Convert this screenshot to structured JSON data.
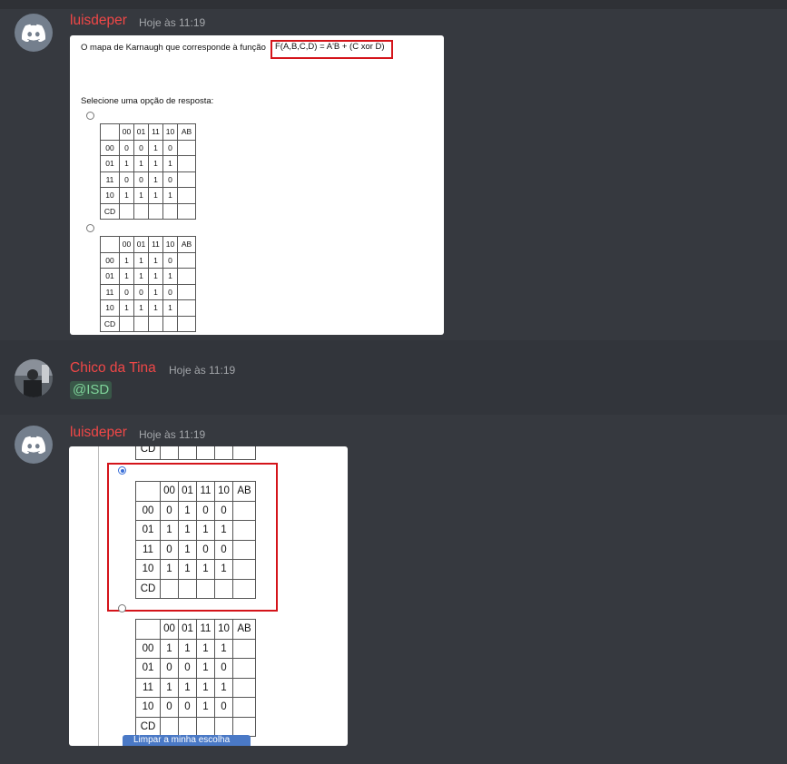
{
  "messages": [
    {
      "username": "luisdeper",
      "timestamp": "Hoje às 11:19"
    },
    {
      "username": "Chico da Tina",
      "timestamp": "Hoje às 11:19",
      "mention": "@ISD"
    },
    {
      "username": "luisdeper",
      "timestamp": "Hoje às 11:19"
    }
  ],
  "screenshot1": {
    "question": "O mapa de Karnaugh que corresponde  à função",
    "formula": "F(A,B,C,D) = A'B + (C xor D)",
    "select_text": "Selecione uma opção de resposta:",
    "header": [
      "",
      "00",
      "01",
      "11",
      "10",
      "AB"
    ],
    "tables": [
      [
        [
          "00",
          "0",
          "0",
          "1",
          "0",
          ""
        ],
        [
          "01",
          "1",
          "1",
          "1",
          "1",
          ""
        ],
        [
          "11",
          "0",
          "0",
          "1",
          "0",
          ""
        ],
        [
          "10",
          "1",
          "1",
          "1",
          "1",
          ""
        ],
        [
          "CD",
          "",
          "",
          "",
          "",
          ""
        ]
      ],
      [
        [
          "00",
          "1",
          "1",
          "1",
          "0",
          ""
        ],
        [
          "01",
          "1",
          "1",
          "1",
          "1",
          ""
        ],
        [
          "11",
          "0",
          "0",
          "1",
          "0",
          ""
        ],
        [
          "10",
          "1",
          "1",
          "1",
          "1",
          ""
        ],
        [
          "CD",
          "",
          "",
          "",
          "",
          ""
        ]
      ]
    ]
  },
  "screenshot2": {
    "top_cell": "CD",
    "header": [
      "",
      "00",
      "01",
      "11",
      "10",
      "AB"
    ],
    "tables": [
      [
        [
          "00",
          "0",
          "1",
          "0",
          "0",
          ""
        ],
        [
          "01",
          "1",
          "1",
          "1",
          "1",
          ""
        ],
        [
          "11",
          "0",
          "1",
          "0",
          "0",
          ""
        ],
        [
          "10",
          "1",
          "1",
          "1",
          "1",
          ""
        ],
        [
          "CD",
          "",
          "",
          "",
          "",
          ""
        ]
      ],
      [
        [
          "00",
          "1",
          "1",
          "1",
          "1",
          ""
        ],
        [
          "01",
          "0",
          "0",
          "1",
          "0",
          ""
        ],
        [
          "11",
          "1",
          "1",
          "1",
          "1",
          ""
        ],
        [
          "10",
          "0",
          "0",
          "1",
          "0",
          ""
        ],
        [
          "CD",
          "",
          "",
          "",
          "",
          ""
        ]
      ]
    ],
    "button_label": "Limpar a minha escolha"
  },
  "colors": {
    "username": "#f04747",
    "mention_bg": "rgba(87,242,135,0.18)",
    "highlight_box": "#d4141a",
    "radio_selected": "#3a6fd8"
  },
  "icons": {
    "discord_avatar": "discord-logo-icon",
    "user_avatar": "photo-avatar"
  }
}
